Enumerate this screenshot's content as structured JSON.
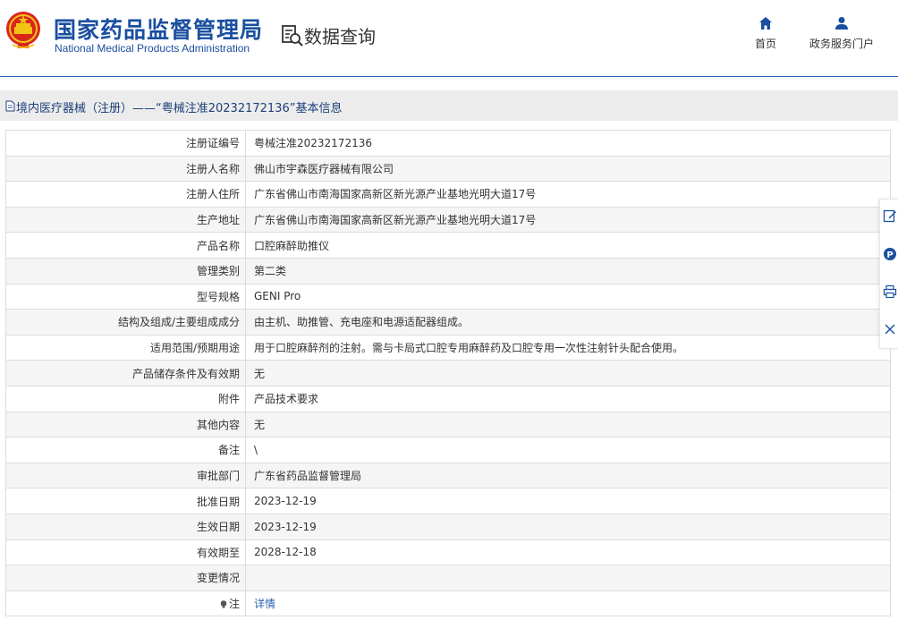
{
  "header": {
    "org_name_cn": "国家药品监督管理局",
    "org_name_en": "National Medical Products Administration",
    "section_title": "数据查询",
    "nav": [
      {
        "label": "首页",
        "icon": "home-icon"
      },
      {
        "label": "政务服务门户",
        "icon": "user-icon"
      }
    ]
  },
  "record": {
    "title": "境内医疗器械（注册）——“粤械注准20232172136”基本信息",
    "rows": [
      {
        "label": "注册证编号",
        "value": "粤械注准20232172136"
      },
      {
        "label": "注册人名称",
        "value": "佛山市宇森医疗器械有限公司"
      },
      {
        "label": "注册人住所",
        "value": "广东省佛山市南海国家高新区新光源产业基地光明大道17号"
      },
      {
        "label": "生产地址",
        "value": "广东省佛山市南海国家高新区新光源产业基地光明大道17号"
      },
      {
        "label": "产品名称",
        "value": "口腔麻醉助推仪"
      },
      {
        "label": "管理类别",
        "value": "第二类"
      },
      {
        "label": "型号规格",
        "value": "GENI Pro"
      },
      {
        "label": "结构及组成/主要组成成分",
        "value": "由主机、助推管、充电座和电源适配器组成。"
      },
      {
        "label": "适用范围/预期用途",
        "value": "用于口腔麻醉剂的注射。需与卡局式口腔专用麻醉药及口腔专用一次性注射针头配合使用。"
      },
      {
        "label": "产品储存条件及有效期",
        "value": "无"
      },
      {
        "label": "附件",
        "value": "产品技术要求"
      },
      {
        "label": "其他内容",
        "value": "无"
      },
      {
        "label": "备注",
        "value": "\\"
      },
      {
        "label": "审批部门",
        "value": "广东省药品监督管理局"
      },
      {
        "label": "批准日期",
        "value": "2023-12-19"
      },
      {
        "label": "生效日期",
        "value": "2023-12-19"
      },
      {
        "label": "有效期至",
        "value": "2028-12-18"
      },
      {
        "label": "变更情况",
        "value": ""
      }
    ],
    "note_label": "注",
    "note_link": "详情"
  },
  "side_tools": [
    "edit-icon",
    "parking-icon",
    "print-icon",
    "close-icon"
  ],
  "colors": {
    "brand_blue": "#1a4fa0",
    "link_blue": "#2a64b0",
    "title_bar": "#ececec"
  }
}
